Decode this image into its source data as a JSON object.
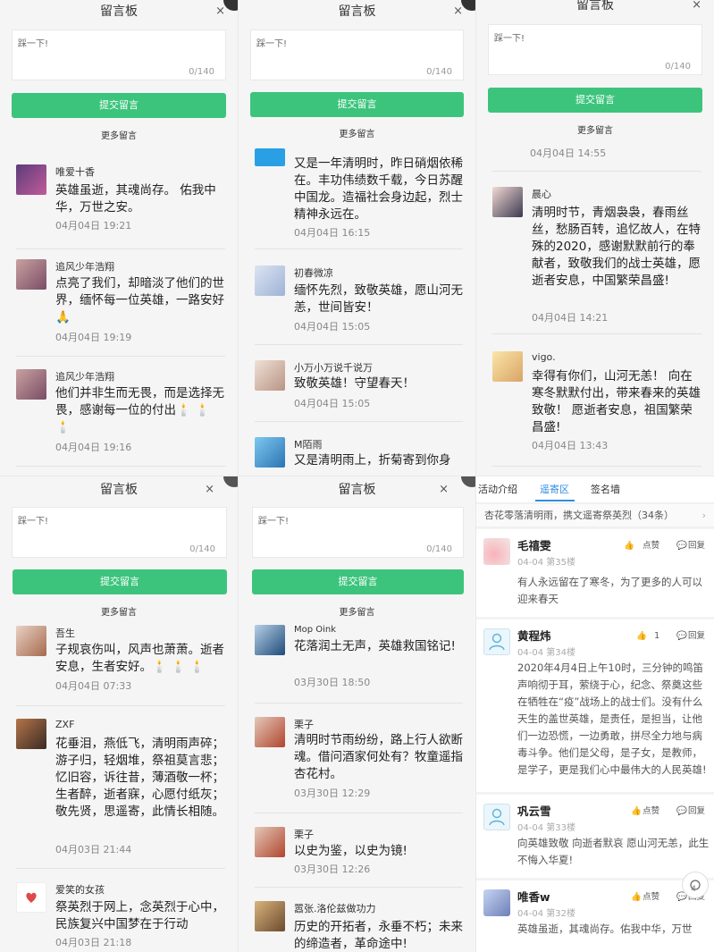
{
  "board": {
    "title": "留言板",
    "close": "×",
    "placeholder": "踩一下!",
    "counter": "0/140",
    "submit": "提交留言",
    "more": "更多留言"
  },
  "panels": {
    "tl": {
      "comments": [
        {
          "name": "唯爱十香",
          "body": "英雄虽逝，其魂尚存。 佑我中华，万世之安。",
          "time": "04月04日 19:21"
        },
        {
          "name": "追风少年浩翔",
          "body": "点亮了我们，却暗淡了他们的世界，缅怀每一位英雄，一路安好🙏",
          "time": "04月04日 19:19"
        },
        {
          "name": "追风少年浩翔",
          "body": "他们并非生而无畏，而是选择无畏，感谢每一位的付出🕯️ 🕯️ 🕯️",
          "time": "04月04日 19:16"
        }
      ]
    },
    "tm": {
      "comments": [
        {
          "name": "",
          "body": "又是一年清明时，昨日硝烟依稀在。丰功伟绩数千载，今日苏醒中国龙。造福社会身边起，烈士精神永远在。",
          "time": "04月04日 16:15"
        },
        {
          "name": "初春微凉",
          "body": "缅怀先烈，致敬英雄，愿山河无恙，世间皆安！",
          "time": "04月04日 15:05"
        },
        {
          "name": "小万小万说千说万",
          "body": "致敬英雄！守望春天！",
          "time": "04月04日 15:05"
        },
        {
          "name": "M陌雨",
          "body": "又是清明雨上，折菊寄到你身",
          "time": ""
        }
      ]
    },
    "tr": {
      "first_time": "04月04日 14:55",
      "comments": [
        {
          "name": "晨心",
          "body": "清明时节，青烟袅袅，春雨丝丝，愁肠百转，追忆故人，在特殊的2020，感谢默默前行的奉献者，致敬我们的战士英雄，愿逝者安息，中国繁荣昌盛!",
          "time": "04月04日 14:21"
        },
        {
          "name": "vigo.",
          "body": "幸得有你们，山河无恙！ 向在寒冬默默付出，带来春来的英雄致敬！ 愿逝者安息，祖国繁荣昌盛!",
          "time": "04月04日 13:43"
        }
      ]
    },
    "bl": {
      "comments": [
        {
          "name": "吾生",
          "body": "子规哀伤叫，风声也萧萧。逝者安息，生者安好。🕯️ 🕯️ 🕯️",
          "time": "04月04日 07:33"
        },
        {
          "name": "ZXF",
          "body": "花垂泪，燕低飞，清明雨声碎；游子归，轻烟堆，祭祖莫言悲；忆旧容，诉往昔，薄酒敬一杯；生者醉，逝者寐，心愿付纸灰；敬先贤，思遥寄，此情长相随。",
          "time": "04月03日 21:44"
        },
        {
          "name": "爱笑的女孩",
          "body": "祭英烈于网上，念英烈于心中，民族复兴中国梦在于行动",
          "time": "04月03日 21:18"
        }
      ]
    },
    "bm": {
      "comments": [
        {
          "name": "Mop Oink",
          "body": "花落润土无声，英雄救国铭记!",
          "time": "03月30日 18:50"
        },
        {
          "name": "栗子",
          "body": "清明时节雨纷纷，路上行人欲断魂。借问酒家何处有？牧童遥指杏花村。",
          "time": "03月30日 12:29"
        },
        {
          "name": "栗子",
          "body": "以史为鉴，以史为镜!",
          "time": "03月30日 12:26"
        },
        {
          "name": "嚣张.洛伦兹做功力",
          "body": "历史的开拓者，永垂不朽；未来的缔造者，革命途中!",
          "time": ""
        }
      ]
    },
    "br": {
      "tabs": [
        "活动介绍",
        "遥寄区",
        "签名墙"
      ],
      "topic": "杏花零落清明雨，携文遥寄祭英烈（34条）",
      "topic_arrow": "›",
      "like_label": "点赞",
      "reply_label": "回复",
      "fab_count": "4",
      "posts": [
        {
          "name": "毛禧雯",
          "date": "04-04",
          "floor": "第35楼",
          "likes": "",
          "body": "有人永远留在了寒冬，为了更多的人可以迎来春天"
        },
        {
          "name": "黄程炜",
          "date": "04-04",
          "floor": "第34楼",
          "likes": "1",
          "body": "2020年4月4日上午10时，三分钟的鸣笛声响彻于耳，萦绕于心，纪念、祭奠这些在牺牲在“疫”战场上的战士们。没有什么天生的盖世英雄，是责任，是担当，让他们一边恐慌，一边勇敢，拼尽全力地与病毒斗争。他们是父母，是子女，是教师，是学子，更是我们心中最伟大的人民英雄!"
        },
        {
          "name": "巩云雪",
          "date": "04-04",
          "floor": "第33楼",
          "likes": "",
          "body": "向英雄致敬 向逝者默哀 愿山河无恙，此生不悔入华夏!"
        },
        {
          "name": "唯香w",
          "date": "04-04",
          "floor": "第32楼",
          "likes": "",
          "body": "英雄虽逝，其魂尚存。佑我中华，万世"
        }
      ]
    }
  },
  "colors": {
    "accent": "#3cc47c",
    "tab_active": "#2e8ee0"
  }
}
